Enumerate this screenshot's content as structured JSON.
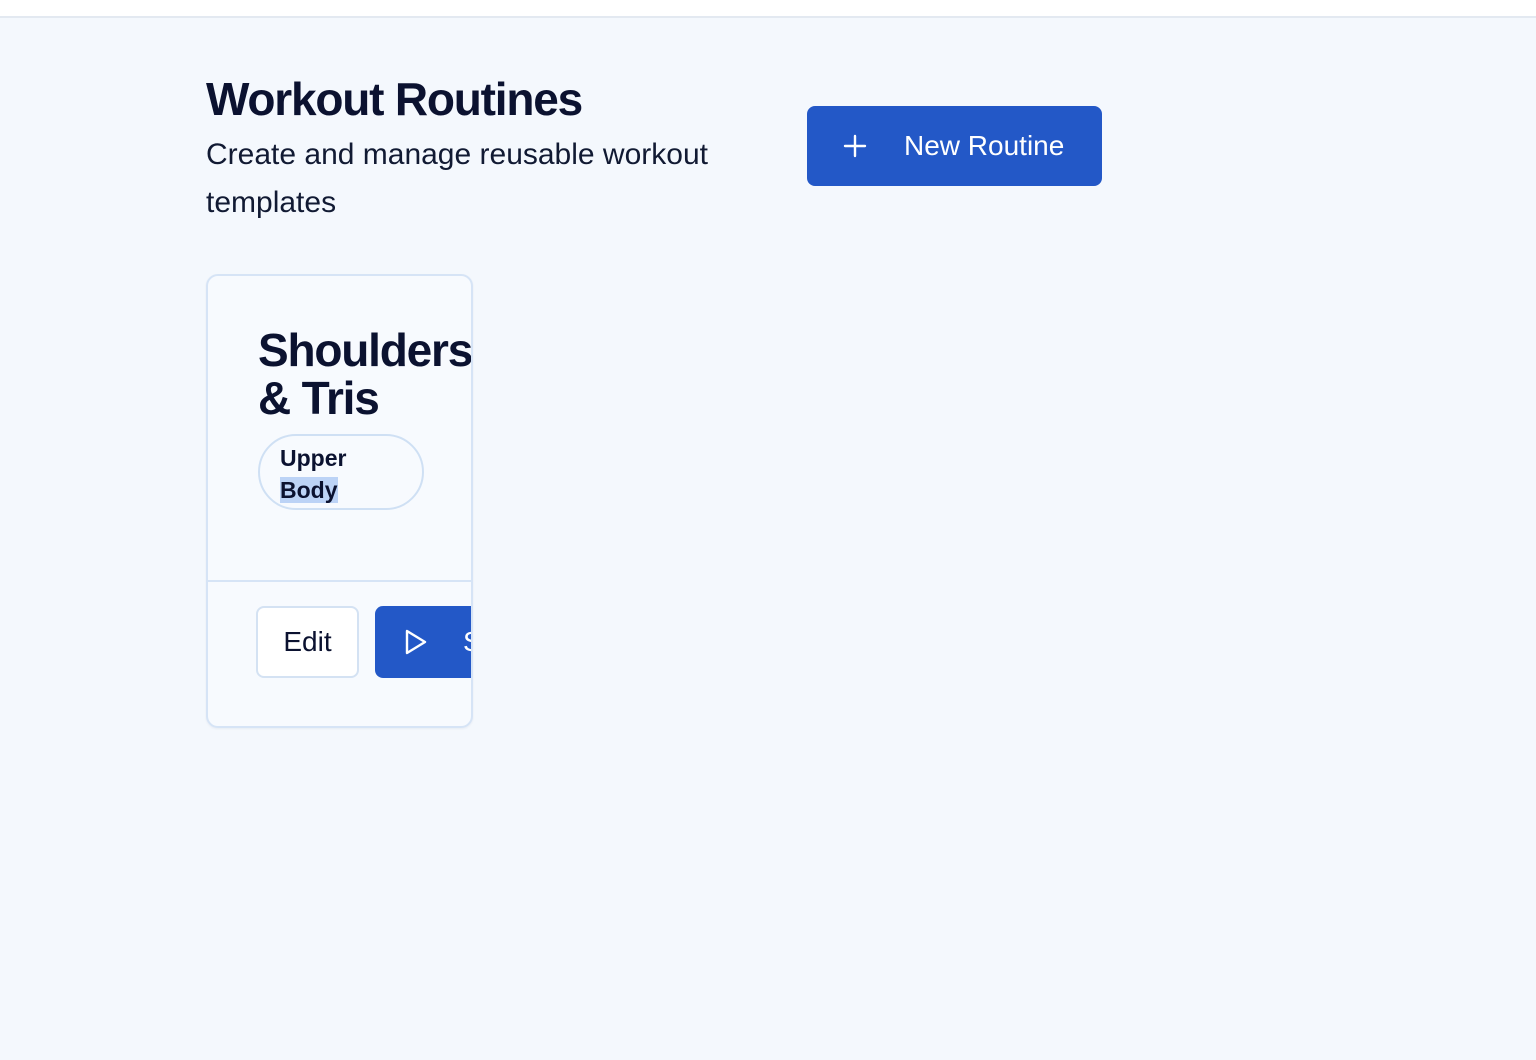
{
  "header": {
    "title": "Workout Routines",
    "subtitle": "Create and manage reusable workout templates",
    "new_routine_label": "New Routine",
    "new_routine_icon": "plus-icon"
  },
  "routines": [
    {
      "name": "Shoulders & Tris",
      "category_first": "Upper",
      "category_selected": "Body",
      "edit_label": "Edit",
      "start_label": "Start",
      "start_icon": "play-icon"
    }
  ],
  "colors": {
    "background": "#f4f8fd",
    "primary": "#2358c7",
    "border": "#d6e4f6",
    "text": "#0b1230"
  }
}
